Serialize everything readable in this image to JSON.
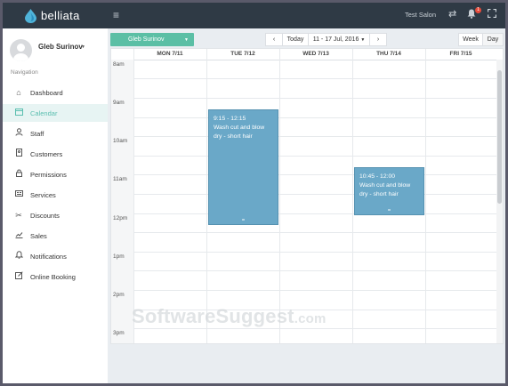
{
  "app": {
    "brand": "belliata",
    "salon_name": "Test Salon",
    "notification_count": "1"
  },
  "user": {
    "name": "Gleb Surinov"
  },
  "sidebar": {
    "heading": "Navigation",
    "items": [
      {
        "label": "Dashboard",
        "icon": "home-icon"
      },
      {
        "label": "Calendar",
        "icon": "calendar-icon",
        "active": true
      },
      {
        "label": "Staff",
        "icon": "person-icon"
      },
      {
        "label": "Customers",
        "icon": "address-book-icon"
      },
      {
        "label": "Permissions",
        "icon": "lock-icon"
      },
      {
        "label": "Services",
        "icon": "list-card-icon"
      },
      {
        "label": "Discounts",
        "icon": "scissors-icon"
      },
      {
        "label": "Sales",
        "icon": "chart-line-icon"
      },
      {
        "label": "Notifications",
        "icon": "bell-icon"
      },
      {
        "label": "Online Booking",
        "icon": "edit-icon"
      }
    ]
  },
  "toolbar": {
    "staff_selector": "Gleb Surinov",
    "prev": "‹",
    "today": "Today",
    "date_range": "11 - 17 Jul, 2016",
    "next": "›",
    "week": "Week",
    "day": "Day",
    "active_view": "Week"
  },
  "calendar": {
    "days": [
      "MON 7/11",
      "TUE 7/12",
      "WED 7/13",
      "THU 7/14",
      "FRI 7/15"
    ],
    "times": [
      "8am",
      "9am",
      "10am",
      "11am",
      "12pm",
      "1pm",
      "2pm",
      "3pm"
    ],
    "events": [
      {
        "time": "9:15 - 12:15",
        "title": "Wash cut and blow dry - short hair",
        "day": "TUE 7/12"
      },
      {
        "time": "10:45 - 12:00",
        "title": "Wash cut and blow dry - short hair",
        "day": "THU 7/14"
      }
    ]
  },
  "watermark": {
    "main": "SoftwareSuggest",
    "suffix": ".com"
  },
  "colors": {
    "topbar": "#2f3a45",
    "accent": "#5bbfa5",
    "event": "#6aa8c8",
    "notification": "#e74c3c"
  }
}
